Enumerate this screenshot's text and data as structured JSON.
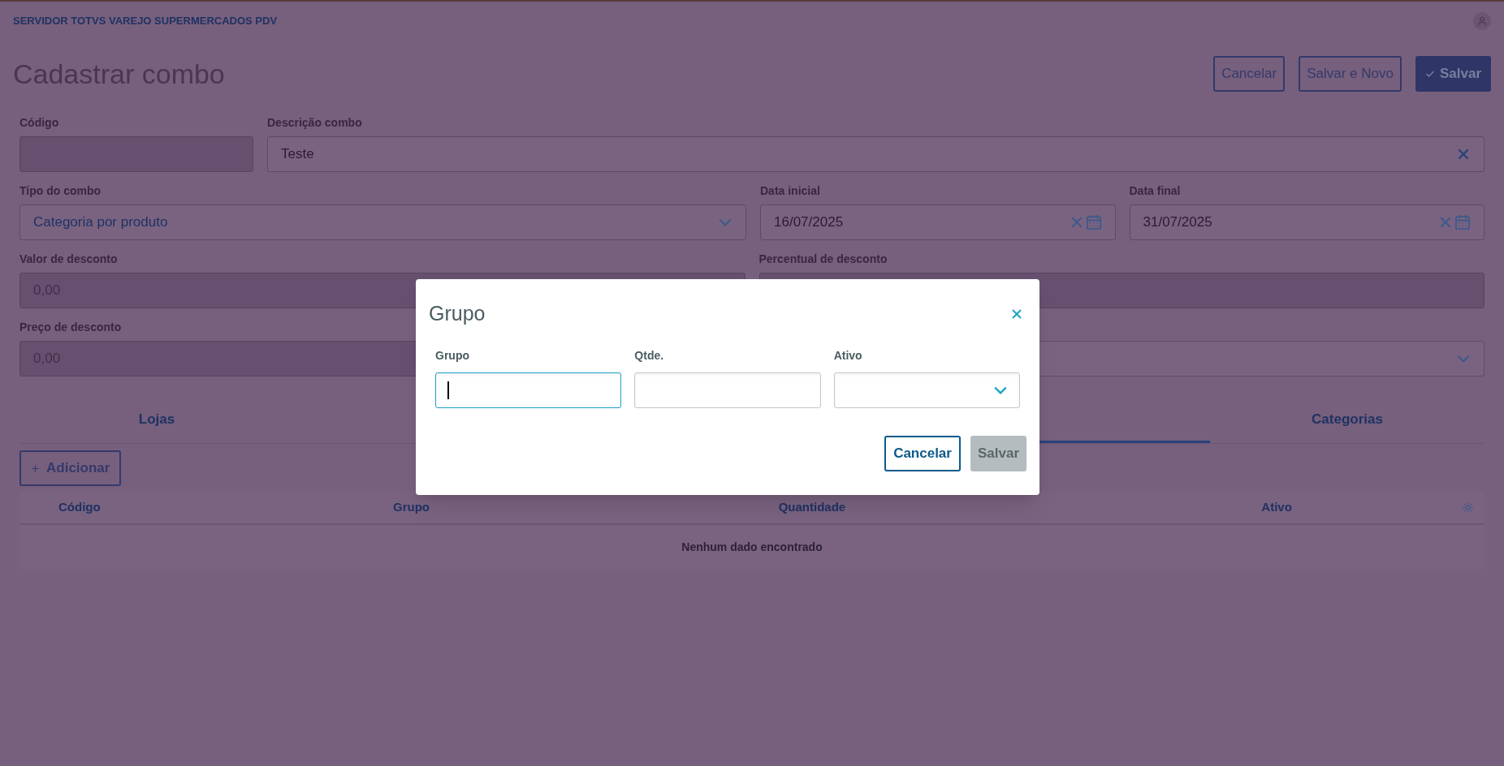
{
  "header": {
    "app_name": "SERVIDOR TOTVS VAREJO SUPERMERCADOS PDV"
  },
  "page": {
    "title": "Cadastrar combo",
    "actions": [
      {
        "label": "Cancelar",
        "kind": "outline"
      },
      {
        "label": "Salvar e Novo",
        "kind": "outline"
      },
      {
        "label": "Salvar",
        "kind": "primary"
      }
    ]
  },
  "form": {
    "rows": [
      [
        {
          "label": "Código",
          "kind": "text",
          "disabled": true
        },
        {
          "label": "Descrição combo",
          "kind": "text",
          "value": "Teste",
          "clearable": true,
          "disabled": false
        }
      ],
      [
        {
          "label": "Tipo do combo",
          "kind": "select",
          "value": "Categoria por produto",
          "disabled": false
        },
        {
          "label": "Data inicial",
          "kind": "date",
          "value": "16/07/2025",
          "disabled": false
        },
        {
          "label": "Data final",
          "kind": "date",
          "value": "31/07/2025",
          "disabled": false
        }
      ],
      [
        {
          "label": "Valor de desconto",
          "kind": "text",
          "placeholder": "0,00",
          "disabled": true
        },
        {
          "label": "Percentual de desconto",
          "kind": "text",
          "disabled": true
        }
      ],
      [
        {
          "label": "Preço de desconto",
          "kind": "text",
          "placeholder": "0,00",
          "disabled": true
        },
        {
          "kind": "select",
          "disabled": false
        }
      ]
    ]
  },
  "tabs": [
    {
      "label": "Lojas",
      "selected": false
    },
    {
      "selected": true
    },
    {
      "label": "Categorias",
      "selected": false
    }
  ],
  "add_button": {
    "label": "Adicionar"
  },
  "table": {
    "columns": [
      "Código",
      "Grupo",
      "Quantidade",
      "Ativo"
    ],
    "empty_message": "Nenhum dado encontrado"
  },
  "dialog": {
    "title": "Grupo",
    "fields": [
      {
        "label": "Grupo",
        "kind": "text",
        "focused": true
      },
      {
        "label": "Qtde.",
        "kind": "text",
        "focused": false
      },
      {
        "label": "Ativo",
        "kind": "select",
        "focused": false
      }
    ],
    "buttons": [
      {
        "label": "Cancelar",
        "disabled": false
      },
      {
        "label": "Salvar",
        "disabled": true
      }
    ]
  }
}
